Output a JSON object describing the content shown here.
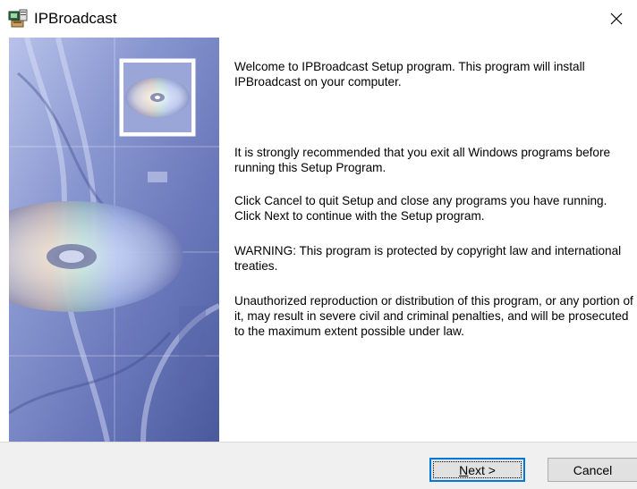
{
  "window": {
    "title": "IPBroadcast",
    "icon": "installer-computer-icon",
    "close_glyph": "✕"
  },
  "banner": {
    "image": "cd-disc-banner-image",
    "thumbnail": "cd-disc-thumbnail-image",
    "colors": {
      "base": "#6f7fb8",
      "highlight": "#c9d3f0",
      "dark": "#3f4f8f"
    }
  },
  "content": {
    "paragraphs": [
      "Welcome to IPBroadcast Setup program. This program will install IPBroadcast on your computer.",
      "It is strongly recommended that you exit all Windows programs before running this Setup Program.",
      "Click Cancel to quit Setup and close any programs you have running.  Click Next to continue with the Setup program.",
      "WARNING: This program is protected by copyright law and international treaties.",
      "Unauthorized reproduction or distribution of this program, or any portion of it, may result in severe civil and criminal penalties, and will be prosecuted to the maximum extent possible under law."
    ]
  },
  "buttons": {
    "next_label": "Next >",
    "cancel_label": "Cancel"
  },
  "colors": {
    "focus": "#0078d7",
    "footer_bg": "#f0f0f0"
  }
}
